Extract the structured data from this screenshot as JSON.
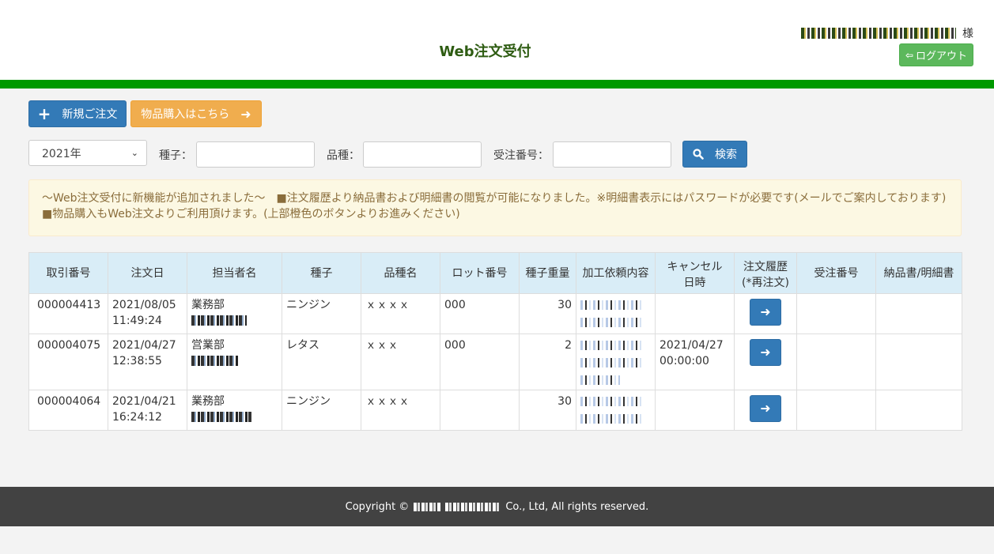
{
  "header": {
    "title": "Web注文受付",
    "user_suffix": "様",
    "logout_icon": "sign-out-icon",
    "logout_label": "ログアウト",
    "brand_color": "#009900"
  },
  "toolbar": {
    "new_order_icon": "plus-icon",
    "new_order_label": "新規ご注文",
    "buy_goods_label": "物品購入はこちら",
    "buy_goods_icon": "arrow-right-icon"
  },
  "filters": {
    "year_value": "2021年",
    "seed_label": "種子：",
    "seed_value": "",
    "variety_label": "品種：",
    "variety_value": "",
    "order_no_label": "受注番号：",
    "order_no_value": "",
    "search_icon": "search-icon",
    "search_label": "検索"
  },
  "notice": {
    "text": "～Web注文受付に新機能が追加されました～　■注文履歴より納品書および明細書の閲覧が可能になりました。※明細書表示にはパスワードが必要です(メールでご案内しております)　■物品購入もWeb注文よりご利用頂けます。(上部橙色のボタンよりお進みください)"
  },
  "table": {
    "headers": {
      "txn_no": "取引番号",
      "order_date": "注文日",
      "person": "担当者名",
      "seed": "種子",
      "variety": "品種名",
      "lot": "ロット番号",
      "weight": "種子重量",
      "processing": "加工依頼内容",
      "cancel_line1": "キャンセル",
      "cancel_line2": "日時",
      "history_line1": "注文履歴",
      "history_line2": "(*再注文)",
      "receive_no": "受注番号",
      "delivery": "納品書/明細書"
    },
    "rows": [
      {
        "txn_no": "000004413",
        "date": "2021/08/05",
        "time": "11:49:24",
        "dept": "業務部",
        "seed": "ニンジン",
        "variety": "ｘｘｘｘ",
        "lot": "000",
        "weight": "30",
        "cancel_date": "",
        "cancel_time": "",
        "action_icon": "arrow-right-icon"
      },
      {
        "txn_no": "000004075",
        "date": "2021/04/27",
        "time": "12:38:55",
        "dept": "営業部",
        "seed": "レタス",
        "variety": "ｘｘｘ",
        "lot": "000",
        "weight": "2",
        "cancel_date": "2021/04/27",
        "cancel_time": "00:00:00",
        "action_icon": "arrow-right-icon"
      },
      {
        "txn_no": "000004064",
        "date": "2021/04/21",
        "time": "16:24:12",
        "dept": "業務部",
        "seed": "ニンジン",
        "variety": "ｘｘｘｘ",
        "lot": "",
        "weight": "30",
        "cancel_date": "",
        "cancel_time": "",
        "action_icon": "arrow-right-icon"
      }
    ]
  },
  "footer": {
    "copyright_prefix": "Copyright ©",
    "copyright_suffix": "Co., Ltd, All rights reserved."
  }
}
